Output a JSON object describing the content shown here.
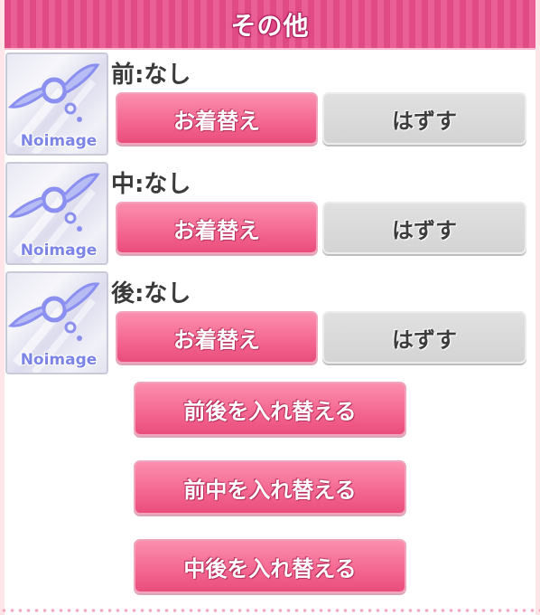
{
  "header": {
    "title": "その他"
  },
  "slots": [
    {
      "label": "前:なし",
      "image_text": "Noimage",
      "wear_label": "お着替え",
      "remove_label": "はずす"
    },
    {
      "label": "中:なし",
      "image_text": "Noimage",
      "wear_label": "お着替え",
      "remove_label": "はずす"
    },
    {
      "label": "後:なし",
      "image_text": "Noimage",
      "wear_label": "お着替え",
      "remove_label": "はずす"
    }
  ],
  "swap_buttons": [
    {
      "label": "前後を入れ替える"
    },
    {
      "label": "前中を入れ替える"
    },
    {
      "label": "中後を入れ替える"
    }
  ],
  "colors": {
    "header": "#e04a85",
    "button_pink": "#f56c94",
    "button_gray": "#d8d8d8"
  },
  "icons": {
    "placeholder": "no-image-placeholder-icon"
  }
}
